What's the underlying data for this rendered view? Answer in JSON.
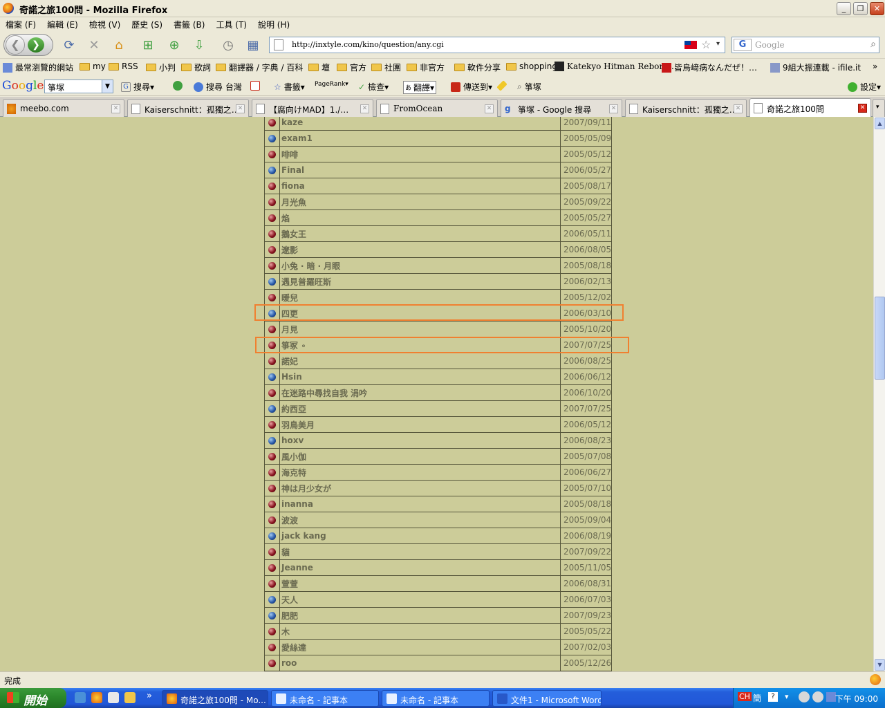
{
  "window": {
    "title": "奇諾之旅100問 - Mozilla Firefox"
  },
  "menu": [
    "檔案 (F)",
    "編輯 (E)",
    "檢視 (V)",
    "歷史 (S)",
    "書籤 (B)",
    "工具 (T)",
    "說明 (H)"
  ],
  "address": {
    "url": "http://inxtyle.com/kino/question/any.cgi"
  },
  "search": {
    "placeholder": "Google"
  },
  "bookmarks": [
    "最常瀏覽的網站",
    "my",
    "RSS",
    "小判",
    "歌詞",
    "翻譯器 / 字典 / 百科",
    "壇",
    "官方",
    "社團",
    "非官方",
    "軟件分享",
    "shopping",
    "Katekyo Hitman Reborn…",
    "皆烏﨑病なんだぜ！…",
    "9組大振連載 - ifile.it"
  ],
  "google_toolbar": {
    "query": "箏塚",
    "search_label": "搜尋",
    "search_tw_label": "搜尋 台灣",
    "bookmarks_label": "書籤",
    "pagerank_label": "PageRank",
    "check_label": "檢查",
    "translate_label": "翻譯",
    "sendto_label": "傳送到",
    "highlight_label": "箏塚",
    "settings_label": "設定"
  },
  "tabs": [
    {
      "label": "meebo.com",
      "active": false
    },
    {
      "label": "Kaiserschnitt：孤獨之…",
      "active": false
    },
    {
      "label": "【腐向けMAD】1./…",
      "active": false
    },
    {
      "label": "FromOcean",
      "active": false
    },
    {
      "label": "箏塚 - Google 搜尋",
      "active": false
    },
    {
      "label": "Kaiserschnitt：孤獨之…",
      "active": false
    },
    {
      "label": "奇諾之旅100問",
      "active": true
    }
  ],
  "rows": [
    {
      "icon": "red",
      "name": "kaze",
      "date": "2007/09/11"
    },
    {
      "icon": "blue",
      "name": "exam1",
      "date": "2005/05/09"
    },
    {
      "icon": "red",
      "name": "啡啡",
      "date": "2005/05/12"
    },
    {
      "icon": "blue",
      "name": "Final",
      "date": "2006/05/27"
    },
    {
      "icon": "red",
      "name": "fiona",
      "date": "2005/08/17"
    },
    {
      "icon": "red",
      "name": "月光魚",
      "date": "2005/09/22"
    },
    {
      "icon": "red",
      "name": "焰",
      "date": "2005/05/27"
    },
    {
      "icon": "red",
      "name": "鵝女王",
      "date": "2006/05/11"
    },
    {
      "icon": "red",
      "name": "遼影",
      "date": "2006/08/05"
    },
    {
      "icon": "red",
      "name": "小兔 ‧ 暗 ‧ 月眼",
      "date": "2005/08/18"
    },
    {
      "icon": "blue",
      "name": "遇見普羅旺斯",
      "date": "2006/02/13"
    },
    {
      "icon": "red",
      "name": "暖兒",
      "date": "2005/12/02"
    },
    {
      "icon": "blue",
      "name": "四更",
      "date": "2006/03/10"
    },
    {
      "icon": "red",
      "name": "月見",
      "date": "2005/10/20"
    },
    {
      "icon": "red",
      "name": "箏冢 ∘",
      "date": "2007/07/25"
    },
    {
      "icon": "red",
      "name": "諾妃",
      "date": "2006/08/25"
    },
    {
      "icon": "blue",
      "name": "Hsin",
      "date": "2006/06/12"
    },
    {
      "icon": "red",
      "name": "在迷路中尋找自我 涓吟",
      "date": "2006/10/20"
    },
    {
      "icon": "blue",
      "name": "約西亞",
      "date": "2007/07/25"
    },
    {
      "icon": "red",
      "name": "羽鳥美月",
      "date": "2006/05/12"
    },
    {
      "icon": "blue",
      "name": "hoxv",
      "date": "2006/08/23"
    },
    {
      "icon": "red",
      "name": "風小伽",
      "date": "2005/07/08"
    },
    {
      "icon": "red",
      "name": "海克特",
      "date": "2006/06/27"
    },
    {
      "icon": "red",
      "name": "神は月少女が",
      "date": "2005/07/10"
    },
    {
      "icon": "red",
      "name": "inanna",
      "date": "2005/08/18"
    },
    {
      "icon": "red",
      "name": "波波",
      "date": "2005/09/04"
    },
    {
      "icon": "blue",
      "name": "jack kang",
      "date": "2006/08/19"
    },
    {
      "icon": "red",
      "name": "貓",
      "date": "2007/09/22"
    },
    {
      "icon": "red",
      "name": "Jeanne",
      "date": "2005/11/05"
    },
    {
      "icon": "red",
      "name": "萱萱",
      "date": "2006/08/31"
    },
    {
      "icon": "blue",
      "name": "天人",
      "date": "2006/07/03"
    },
    {
      "icon": "blue",
      "name": "肥肥",
      "date": "2007/09/23"
    },
    {
      "icon": "red",
      "name": "木",
      "date": "2005/05/22"
    },
    {
      "icon": "red",
      "name": "愛絲達",
      "date": "2007/02/03"
    },
    {
      "icon": "red",
      "name": "roo",
      "date": "2005/12/26"
    }
  ],
  "highlighted_rows": [
    12,
    14
  ],
  "status": {
    "text": "完成"
  },
  "taskbar": {
    "start_label": "開始",
    "tasks": [
      {
        "label": "奇諾之旅100問 - Mo...",
        "active": true
      },
      {
        "label": "未命名 - 記事本",
        "active": false
      },
      {
        "label": "未命名 - 記事本",
        "active": false
      },
      {
        "label": "文件1 - Microsoft Word",
        "active": false
      }
    ],
    "ime": "CH",
    "ime2": "簡",
    "clock": "下午 09:00"
  },
  "colors": {
    "page_bg": "#cccc99",
    "highlight": "#f08030",
    "tab_close_active": "#d8281a"
  }
}
